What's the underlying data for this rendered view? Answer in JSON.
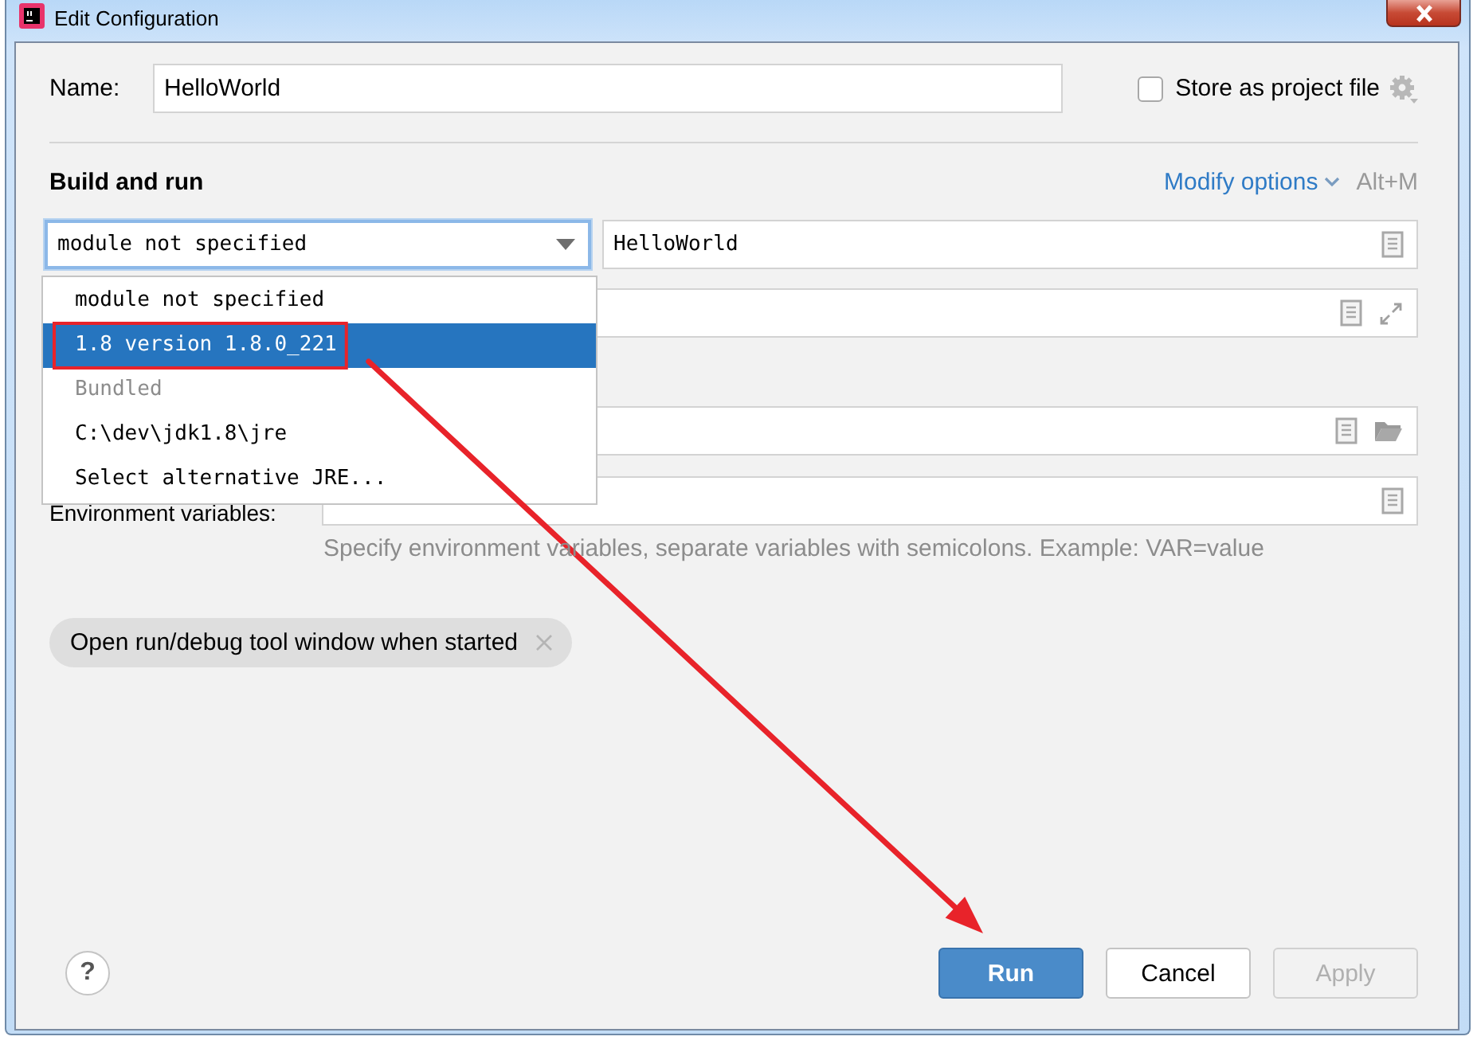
{
  "window": {
    "title": "Edit Configuration"
  },
  "name_field": {
    "label": "Name:",
    "value": "HelloWorld"
  },
  "store_as_project_file": {
    "label": "Store as project file",
    "checked": false
  },
  "section": {
    "title": "Build and run",
    "modify_options": "Modify options",
    "shortcut": "Alt+M"
  },
  "jre_combo": {
    "value": "module not specified",
    "expanded": true
  },
  "main_class_field": {
    "value": "HelloWorld"
  },
  "dropdown": {
    "items": [
      {
        "label": "module not specified",
        "kind": "option",
        "selected": false,
        "highlighted": false
      },
      {
        "label": "1.8 version 1.8.0_221",
        "kind": "option",
        "selected": true,
        "highlighted": true
      },
      {
        "label": "Bundled",
        "kind": "group",
        "selected": false,
        "highlighted": false
      },
      {
        "label": "C:\\dev\\jdk1.8\\jre",
        "kind": "option",
        "selected": false,
        "highlighted": false
      },
      {
        "label": "Select alternative JRE...",
        "kind": "option",
        "selected": false,
        "highlighted": false
      }
    ]
  },
  "env": {
    "label": "Environment variables:",
    "hint": "Specify environment variables, separate variables with semicolons. Example: VAR=value"
  },
  "option_chips": [
    {
      "label": "Open run/debug tool window when started"
    }
  ],
  "help_button": {
    "label": "?"
  },
  "buttons": [
    {
      "label": "Run",
      "kind": "primary",
      "disabled": false
    },
    {
      "label": "Cancel",
      "kind": "normal",
      "disabled": false
    },
    {
      "label": "Apply",
      "kind": "normal",
      "disabled": true
    }
  ]
}
